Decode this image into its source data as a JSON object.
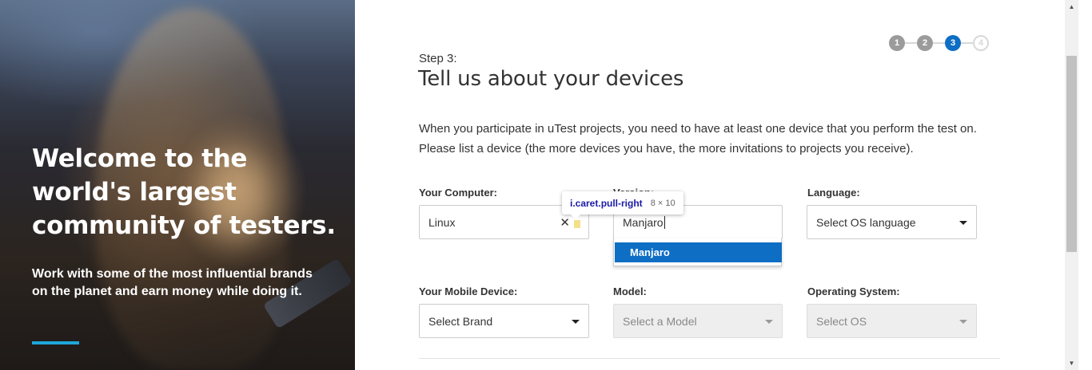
{
  "hero": {
    "title": "Welcome to the world's largest community of testers.",
    "subtitle": "Work with some of the most influential brands on the planet and earn money while doing it."
  },
  "stepper": {
    "steps": [
      "1",
      "2",
      "3",
      "4"
    ],
    "current": 3
  },
  "page": {
    "step_label": "Step 3:",
    "title": "Tell us about your devices",
    "intro": "When you participate in uTest projects, you need to have at least one device that you perform the test on. Please list a device (the more devices you have, the more invitations to projects you receive)."
  },
  "computer": {
    "label": "Your Computer:",
    "value": "Linux",
    "clear_glyph": "✕"
  },
  "version": {
    "label": "Version:",
    "value": "Manjaro",
    "options": [
      "Manjaro"
    ]
  },
  "language": {
    "label": "Language:",
    "value": "Select OS language"
  },
  "mobile": {
    "label": "Your Mobile Device:",
    "value": "Select Brand"
  },
  "model": {
    "label": "Model:",
    "value": "Select a Model"
  },
  "os": {
    "label": "Operating System:",
    "value": "Select OS"
  },
  "tooltip": {
    "selector": "i.caret.pull-right",
    "size": "8 × 10"
  },
  "colors": {
    "accent": "#0d6ec4",
    "hero_bar": "#1ea7d8"
  }
}
